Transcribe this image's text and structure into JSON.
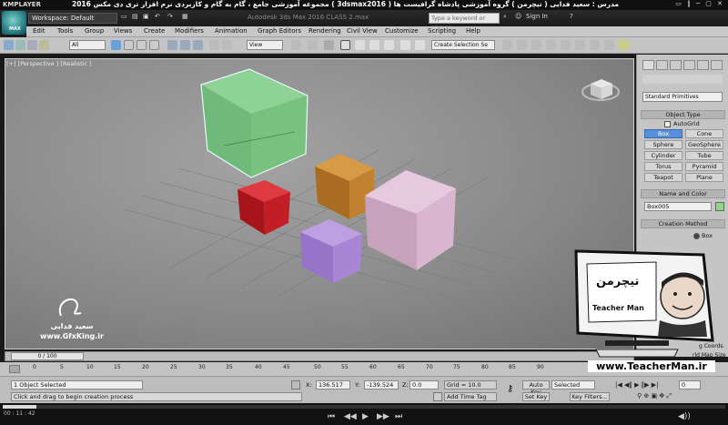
{
  "player": {
    "logo": "KMPLAYER",
    "video_title": "مجموعه آموزشی جامع ، گام به گام و کاربردی نرم افزار تری دی مکس 2016 ( 3dsmax2016 ) مدرس : سعید فدایی ( تیچرمن ) گروه آموزشی پادشاه گرافیست ها",
    "controls": "▭ ‖ ─ ▢ ✕",
    "timecode": "00 : 11 : 42"
  },
  "app": {
    "logo_label": "MAX",
    "workspace": "Workspace: Default",
    "title": "Autodesk 3ds Max 2016    CLASS 2.max",
    "search_placeholder": "Type a keyword or phrase",
    "sign_in": "Sign In",
    "help": "?"
  },
  "menu": [
    "Edit",
    "Tools",
    "Group",
    "Views",
    "Create",
    "Modifiers",
    "Animation",
    "Graph Editors",
    "Rendering",
    "Civil View",
    "Customize",
    "Scripting",
    "Help"
  ],
  "toolbar": {
    "filter": "All",
    "ref_coord": "View",
    "selection_set": "Create Selection Se"
  },
  "viewport": {
    "label": "[+] [Perspective ] [Realistic ]"
  },
  "command_panel": {
    "dropdown": "Standard Primitives",
    "object_type": "Object Type",
    "autogrid": "AutoGrid",
    "buttons": [
      {
        "left": "Box",
        "right": "Cone"
      },
      {
        "left": "Sphere",
        "right": "GeoSphere"
      },
      {
        "left": "Cylinder",
        "right": "Tube"
      },
      {
        "left": "Torus",
        "right": "Pyramid"
      },
      {
        "left": "Teapot",
        "right": "Plane"
      }
    ],
    "name_color": "Name and Color",
    "object_name": "Box005",
    "creation_method": "Creation Method",
    "cm_option": "Box",
    "coords_label": "g Coords.",
    "size_label": "rld Map Size"
  },
  "timeline": {
    "frame": "0 / 100",
    "ticks": [
      "0",
      "5",
      "10",
      "15",
      "20",
      "25",
      "30",
      "35",
      "40",
      "45",
      "50",
      "55",
      "60",
      "65",
      "70",
      "75",
      "80",
      "85",
      "90"
    ]
  },
  "status": {
    "selected": "1 Object Selected",
    "prompt": "Click and drag to begin creation process",
    "x": "136.517",
    "y": "-139.524",
    "z": "0.0",
    "grid": "Grid = 10.0",
    "add_time_tag": "Add Time Tag",
    "auto_key": "Auto Key",
    "set_key": "Set Key",
    "key_mode": "Selected",
    "key_filters": "Key Filters...",
    "frame_field": "0"
  },
  "watermarks": {
    "author": "سعید فدایی",
    "gfx_site": "www.GfxKing.ir",
    "tm_site": "www.TeacherMan.ir",
    "tm_name": "Teacher Man",
    "tm_logo": "تیچرمن"
  },
  "colors": {
    "box_green": "#76c27e",
    "box_orange": "#c08230",
    "box_red": "#c21e27",
    "box_pink": "#d8b6d0",
    "box_purple": "#a985d6",
    "accent_blue": "#5a8ed8"
  }
}
